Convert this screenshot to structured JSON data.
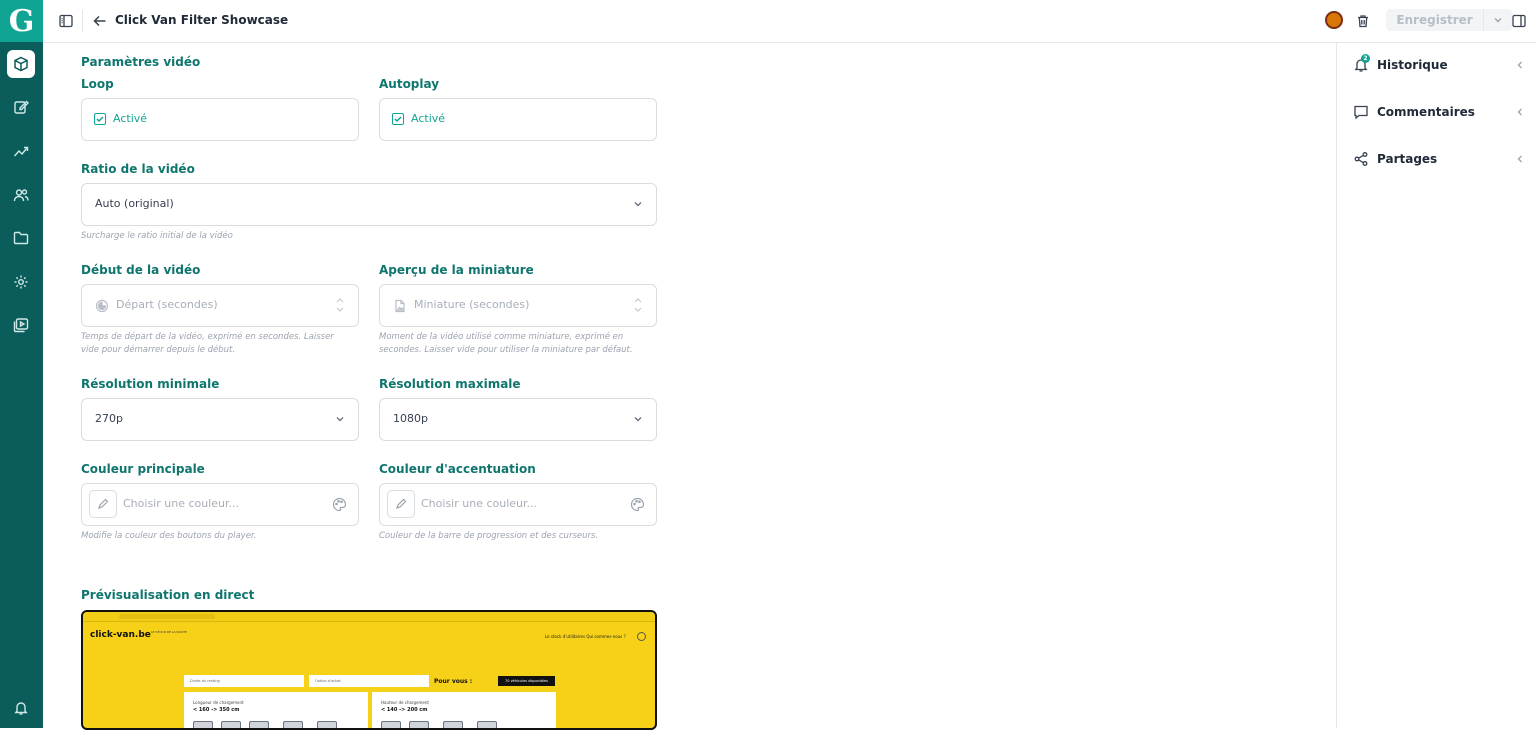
{
  "app": {
    "logo_letter": "G"
  },
  "topbar": {
    "title": "Click Van Filter Showcase",
    "save_label": "Enregistrer"
  },
  "rail": {
    "items": [
      "box-icon",
      "edit-icon",
      "analytics-icon",
      "users-icon",
      "folder-icon",
      "settings-icon",
      "media-library-icon"
    ],
    "bottom": "bell-icon"
  },
  "form": {
    "section_title": "Paramètres vidéo",
    "loop": {
      "label": "Loop",
      "value": "Activé",
      "checked": true
    },
    "autoplay": {
      "label": "Autoplay",
      "value": "Activé",
      "checked": true
    },
    "ratio": {
      "label": "Ratio de la vidéo",
      "value": "Auto (original)",
      "hint": "Surcharge le ratio initial de la vidéo"
    },
    "start": {
      "label": "Début de la vidéo",
      "placeholder": "Départ (secondes)",
      "hint1": "Temps de départ de la vidéo, exprimé en secondes. Laisser",
      "hint2": "vide pour démarrer depuis le début."
    },
    "thumb": {
      "label": "Aperçu de la miniature",
      "placeholder": "Miniature (secondes)",
      "hint1": "Moment de la vidéo utilisé comme miniature, exprimé en",
      "hint2": "secondes. Laisser vide pour utiliser la miniature par défaut."
    },
    "res_min": {
      "label": "Résolution minimale",
      "value": "270p"
    },
    "res_max": {
      "label": "Résolution maximale",
      "value": "1080p"
    },
    "color_main": {
      "label": "Couleur principale",
      "placeholder": "Choisir une couleur...",
      "hint": "Modifie la couleur des boutons du player."
    },
    "color_accent": {
      "label": "Couleur d'accentuation",
      "placeholder": "Choisir une couleur...",
      "hint": "Couleur de la barre de progression et des curseurs."
    },
    "preview_title": "Prévisualisation en direct"
  },
  "preview": {
    "logo": "click-van.be",
    "tagline": "LE STOCK DE LA ROUTE",
    "nav": "Le stock d'utilitaires   Qui sommes-nous ?",
    "input1": "Durée du renting",
    "input2": "Option d'achat",
    "pour_vous": "Pour vous :",
    "badge": "70 véhicules disponibles",
    "card1_title": "Longueur de chargement",
    "card1_value": "< 160 -> 350 cm",
    "card2_title": "Hauteur de chargement",
    "card2_value": "< 140 -> 200 cm",
    "bg_color": "#f7d117"
  },
  "right_panel": {
    "items": [
      {
        "label": "Historique",
        "icon": "history-icon",
        "badge": "2"
      },
      {
        "label": "Commentaires",
        "icon": "comment-icon"
      },
      {
        "label": "Partages",
        "icon": "share-icon"
      }
    ]
  },
  "colors": {
    "accent": "#10a593",
    "rail": "#0b5d5b",
    "label": "#0f766e"
  }
}
